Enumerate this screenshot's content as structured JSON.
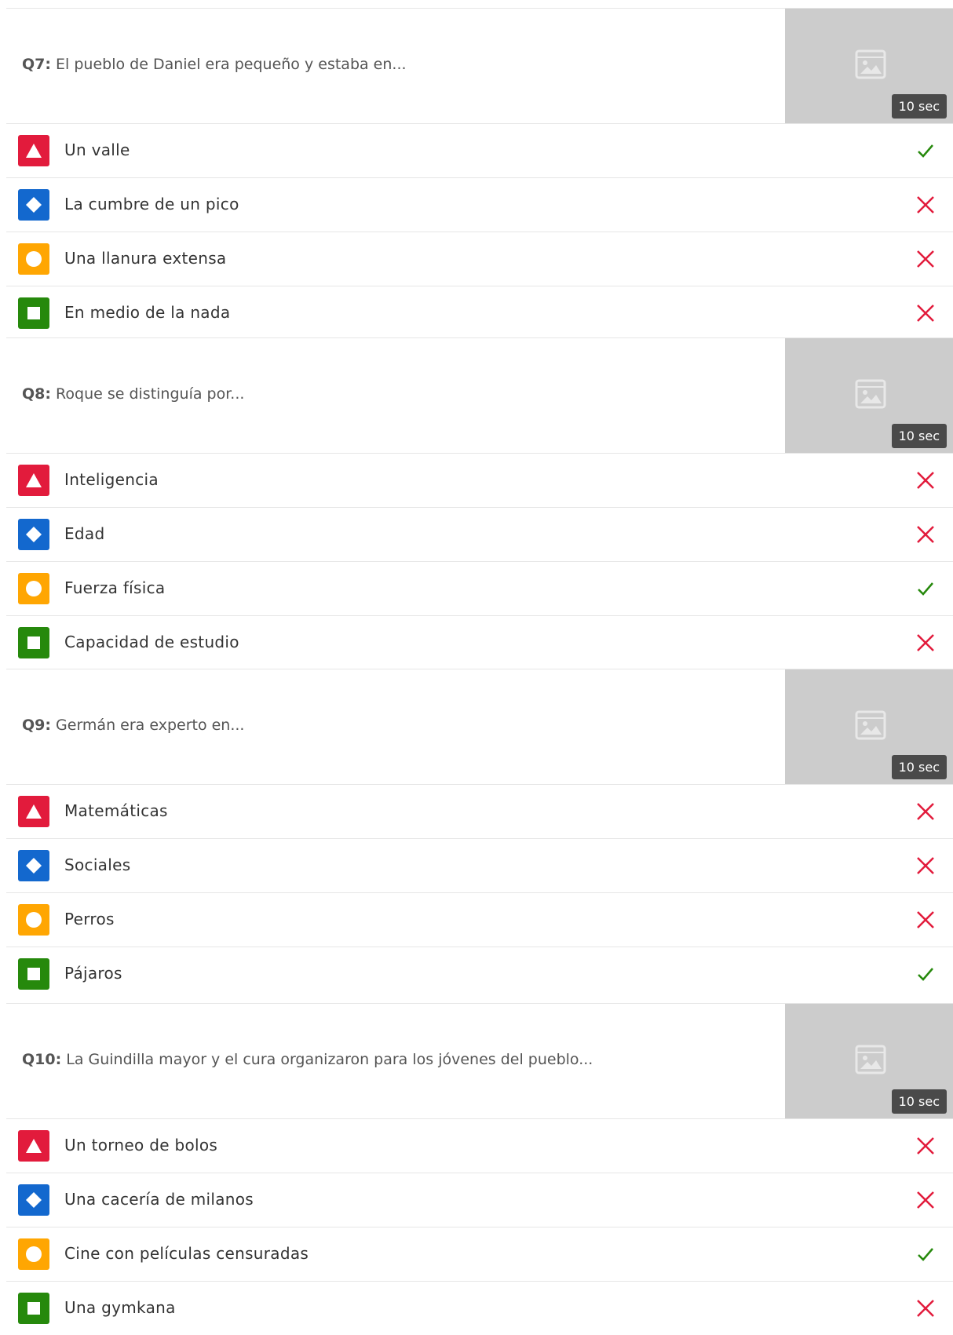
{
  "colors": {
    "triangle": "#e21b3c",
    "diamond": "#1368ce",
    "circle": "#ffa602",
    "square": "#26890c",
    "correct": "#26890c",
    "wrong": "#e21b3c"
  },
  "questions": [
    {
      "number": "Q7:",
      "text": "El pueblo de Daniel era pequeño y estaba en...",
      "time": "10 sec",
      "answers": [
        {
          "shape": "triangle",
          "text": "Un valle",
          "correct": true
        },
        {
          "shape": "diamond",
          "text": "La cumbre de un pico",
          "correct": false
        },
        {
          "shape": "circle",
          "text": "Una llanura extensa",
          "correct": false
        },
        {
          "shape": "square",
          "text": "En medio de la nada",
          "correct": false
        }
      ]
    },
    {
      "number": "Q8:",
      "text": "Roque se distinguía por...",
      "time": "10 sec",
      "answers": [
        {
          "shape": "triangle",
          "text": "Inteligencia",
          "correct": false
        },
        {
          "shape": "diamond",
          "text": "Edad",
          "correct": false
        },
        {
          "shape": "circle",
          "text": "Fuerza física",
          "correct": true
        },
        {
          "shape": "square",
          "text": "Capacidad de estudio",
          "correct": false
        }
      ]
    },
    {
      "number": "Q9:",
      "text": "Germán era experto en...",
      "time": "10 sec",
      "answers": [
        {
          "shape": "triangle",
          "text": "Matemáticas",
          "correct": false
        },
        {
          "shape": "diamond",
          "text": "Sociales",
          "correct": false
        },
        {
          "shape": "circle",
          "text": "Perros",
          "correct": false
        },
        {
          "shape": "square",
          "text": "Pájaros",
          "correct": true
        }
      ]
    },
    {
      "number": "Q10:",
      "text": "La Guindilla mayor y el cura organizaron para los jóvenes del pueblo...",
      "time": "10 sec",
      "answers": [
        {
          "shape": "triangle",
          "text": "Un torneo de bolos",
          "correct": false
        },
        {
          "shape": "diamond",
          "text": "Una cacería de milanos",
          "correct": false
        },
        {
          "shape": "circle",
          "text": "Cine con películas censuradas",
          "correct": true
        },
        {
          "shape": "square",
          "text": "Una gymkana",
          "correct": false
        }
      ]
    }
  ]
}
